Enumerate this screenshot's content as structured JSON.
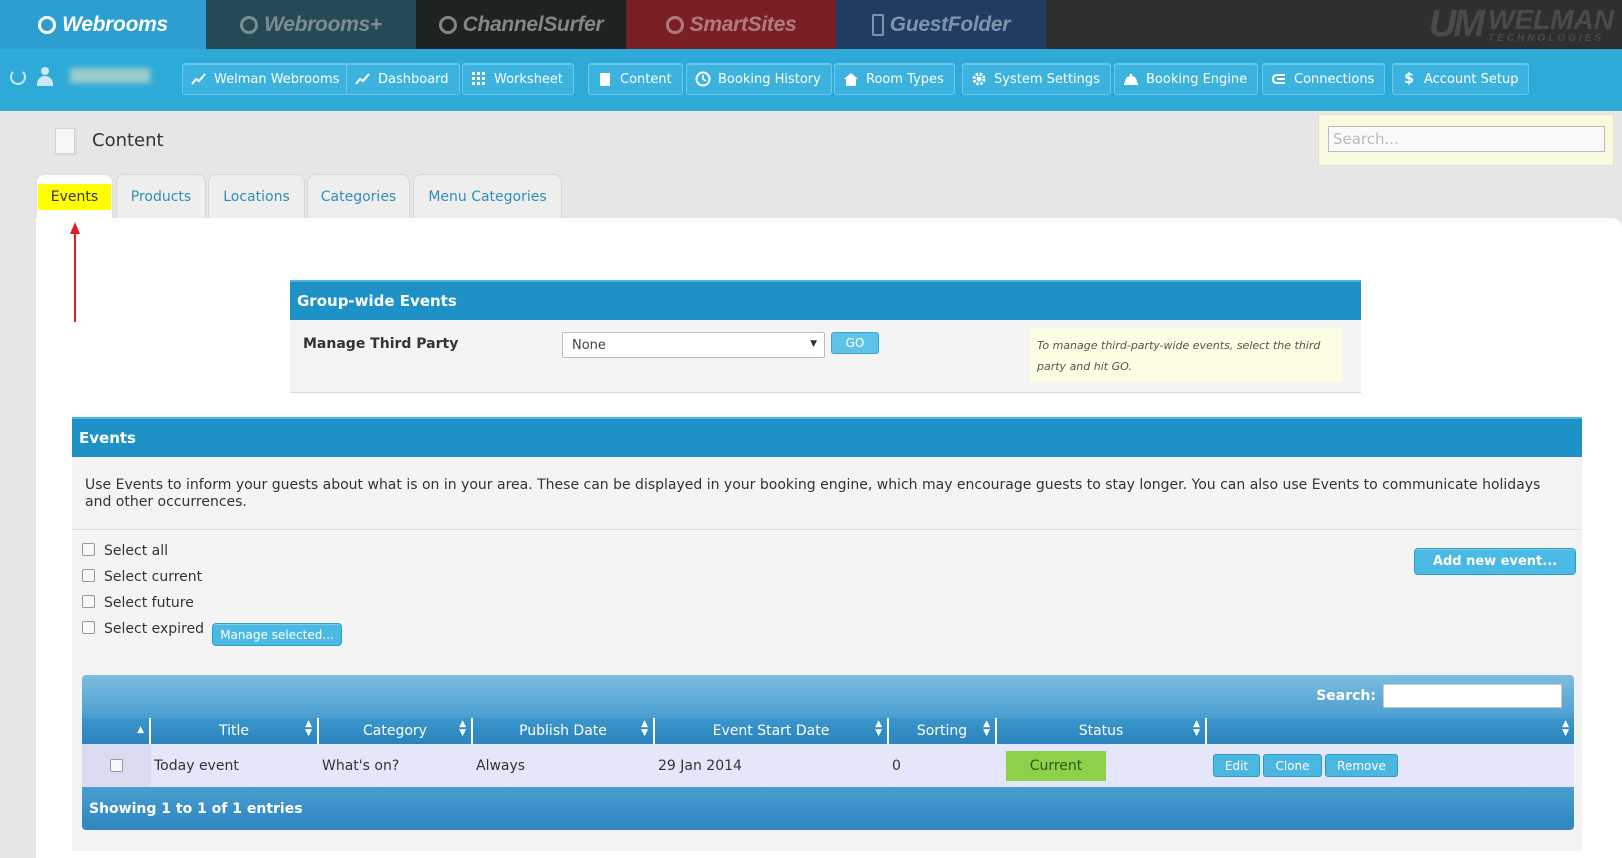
{
  "products": [
    {
      "label": "Webrooms"
    },
    {
      "label": "Webrooms+"
    },
    {
      "label": "ChannelSurfer"
    },
    {
      "label": "SmartSites"
    },
    {
      "label": "GuestFolder"
    }
  ],
  "brand": {
    "mark": "UM",
    "name": "WELMAN",
    "tagline": "TECHNOLOGIES"
  },
  "nav": {
    "items": [
      {
        "label": "Welman Webrooms",
        "icon": "chart-line-icon"
      },
      {
        "label": "Dashboard",
        "icon": "chart-line-icon"
      },
      {
        "label": "Worksheet",
        "icon": "grid-icon"
      },
      {
        "label": "Content",
        "icon": "document-icon"
      },
      {
        "label": "Booking History",
        "icon": "history-icon"
      },
      {
        "label": "Room Types",
        "icon": "home-icon"
      },
      {
        "label": "System Settings",
        "icon": "gear-icon"
      },
      {
        "label": "Booking Engine",
        "icon": "bell-icon"
      },
      {
        "label": "Connections",
        "icon": "connections-icon"
      },
      {
        "label": "Account Setup",
        "icon": "dollar-icon"
      }
    ]
  },
  "page": {
    "title": "Content",
    "search_placeholder": "Search..."
  },
  "tabs": [
    {
      "label": "Events",
      "active": true
    },
    {
      "label": "Products"
    },
    {
      "label": "Locations"
    },
    {
      "label": "Categories"
    },
    {
      "label": "Menu Categories"
    }
  ],
  "group_events": {
    "title": "Group-wide Events",
    "manage_label": "Manage Third Party",
    "select_value": "None",
    "go_label": "GO",
    "hint": "To manage third-party-wide events, select the third party and hit GO."
  },
  "events": {
    "title": "Events",
    "description": "Use Events to inform your guests about what is on in your area. These can be displayed in your booking engine, which may encourage guests to stay longer. You can also use Events to communicate holidays and other occurrences.",
    "select_all": "Select all",
    "select_current": "Select current",
    "select_future": "Select future",
    "select_expired": "Select expired",
    "manage_selected": "Manage selected...",
    "add_new": "Add new event..."
  },
  "table": {
    "search_label": "Search:",
    "columns": [
      "",
      "Title",
      "Category",
      "Publish Date",
      "Event Start Date",
      "Sorting",
      "Status",
      ""
    ],
    "rows": [
      {
        "title": "Today event",
        "category": "What's on?",
        "publish_date": "Always",
        "start_date": "29 Jan 2014",
        "sorting": "0",
        "status": "Current"
      }
    ],
    "actions": {
      "edit": "Edit",
      "clone": "Clone",
      "remove": "Remove"
    },
    "footer": "Showing 1 to 1 of 1 entries"
  },
  "colors": {
    "accent": "#2eaad8",
    "panel_header": "#1e92c6",
    "status_current": "#8dd14a",
    "highlight": "#ffff00"
  }
}
